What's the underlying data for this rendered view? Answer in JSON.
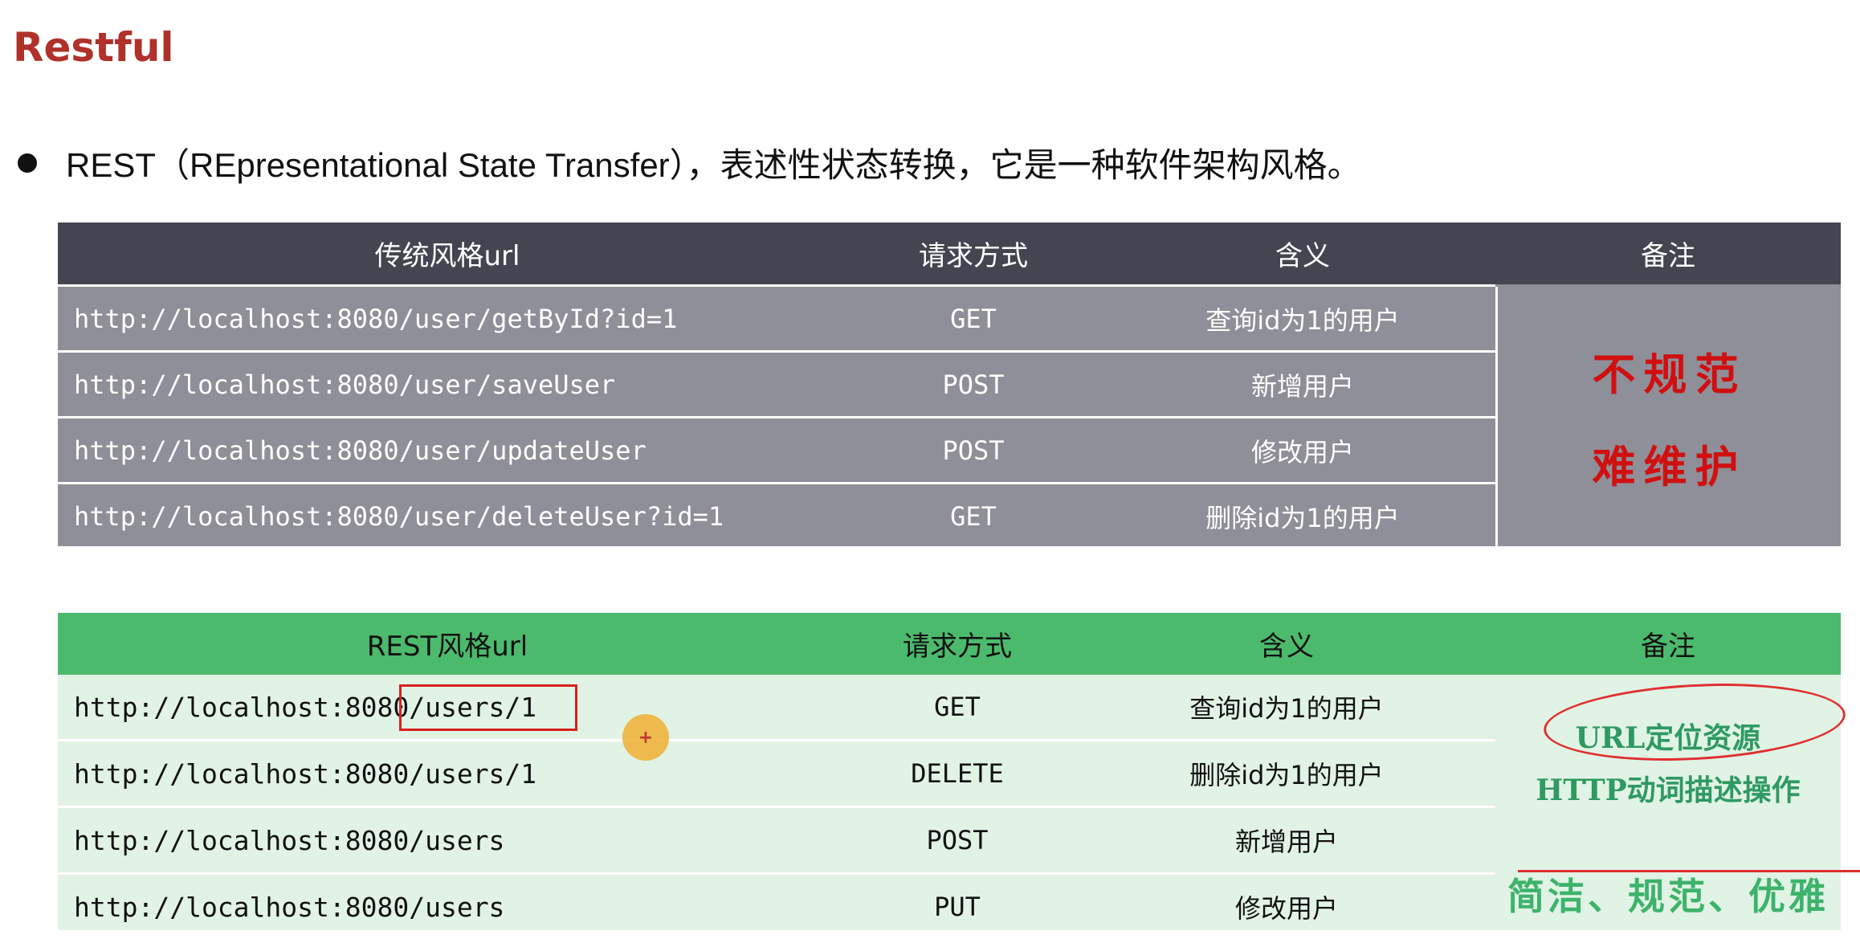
{
  "title": "Restful",
  "bullet": "REST（REpresentational State Transfer），表述性状态转换，它是一种软件架构风格。",
  "table1": {
    "headers": [
      "传统风格url",
      "请求方式",
      "含义",
      "备注"
    ],
    "rows": [
      [
        "http://localhost:8080/user/getById?id=1",
        "GET",
        "查询id为1的用户"
      ],
      [
        "http://localhost:8080/user/saveUser",
        "POST",
        "新增用户"
      ],
      [
        "http://localhost:8080/user/updateUser",
        "POST",
        "修改用户"
      ],
      [
        "http://localhost:8080/user/deleteUser?id=1",
        "GET",
        "删除id为1的用户"
      ]
    ],
    "note_lines": [
      "不规范",
      "难维护"
    ]
  },
  "table2": {
    "headers": [
      "REST风格url",
      "请求方式",
      "含义",
      "备注"
    ],
    "rows": [
      [
        "http://localhost:8080/users/1",
        "GET",
        "查询id为1的用户"
      ],
      [
        "http://localhost:8080/users/1",
        "DELETE",
        "删除id为1的用户"
      ],
      [
        "http://localhost:8080/users",
        "POST",
        "新增用户"
      ],
      [
        "http://localhost:8080/users",
        "PUT",
        "修改用户"
      ]
    ],
    "note_lines": [
      "URL定位资源",
      "HTTP动词描述操作",
      "简洁、规范、优雅"
    ]
  },
  "colors": {
    "title": "#b0302a",
    "table1_header": "#434650",
    "table1_body": "#8e8f98",
    "table2_header": "#4cba6c",
    "table2_body": "#e1f3e5",
    "annotation_red": "#d01010",
    "annotation_green": "#2e9a62"
  }
}
